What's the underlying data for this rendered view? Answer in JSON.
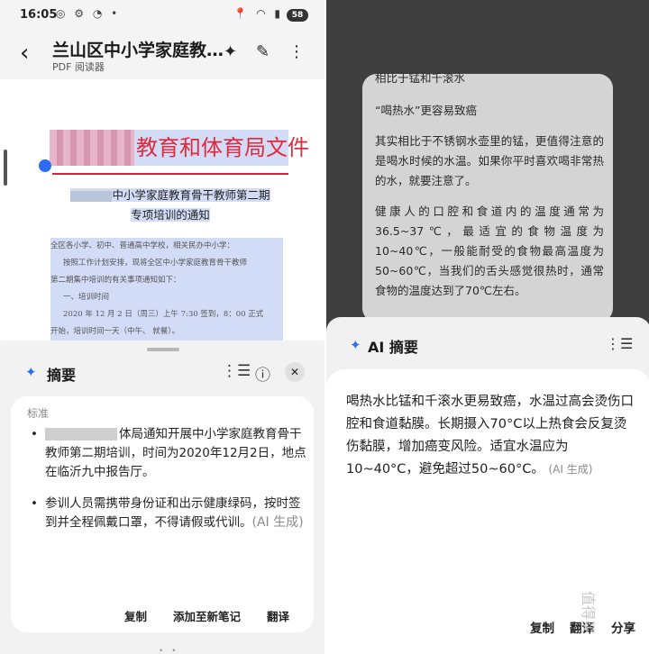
{
  "left": {
    "status": {
      "time": "16:05",
      "left_icons": "◎ ⚙ ◔ •",
      "right_icons": "📍 ◠ ▮",
      "battery": "58"
    },
    "appbar": {
      "title": "兰山区中小学家庭教…",
      "subtitle": "PDF 阅读器"
    },
    "document": {
      "heading_visible": "教育和体育局文件",
      "subheading_line1": "中小学家庭教育骨干教师第二期",
      "subheading_line2": "专项培训的通知",
      "body_lines": [
        "全区各小学、初中、普通高中学校，相关民办中小学：",
        "按照工作计划安排，现将全区中小学家庭教育骨干教师",
        "第二期集中培训的有关事项通知如下：",
        "一、培训时间",
        "2020 年 12 月 2 日（周三）上午 7:30 签到，8：00 正式",
        "开始，培训时间一天（中午、          就餐）。"
      ]
    },
    "summary_sheet": {
      "title": "摘要",
      "label": "标准",
      "bullet1_visible": "体局通知开展中小学家庭教育骨干教师第二期培训，时间为2020年12月2日，地点在临沂九中报告厅。",
      "bullet2": "参训人员需携带身份证和出示健康绿码，按时签到并全程佩戴口罩，不得请假或代训。",
      "ai_tag": "(AI 生成)",
      "actions": {
        "copy": "复制",
        "add_note": "添加至新笔记",
        "translate": "翻译"
      }
    }
  },
  "right": {
    "background_text": {
      "line1": "相比于锰和千滚水",
      "line2": "“喝热水”更容易致癌",
      "para1": "其实相比于不锈钢水壶里的锰，更值得注意的是喝水时候的水温。如果你平时喜欢喝非常热的水，就要注意了。",
      "para2": "健康人的口腔和食道内的温度通常为36.5~37℃，最适宜的食物温度为10~40℃，一般能耐受的食物最高温度为50~60℃，当我们的舌头感觉很热时，通常食物的温度达到了70℃左右。"
    },
    "ai_sheet": {
      "title": "AI 摘要",
      "summary": "喝热水比锰和千滚水更易致癌，水温过高会烫伤口腔和食道黏膜。长期摄入70°C以上热食会反复烫伤黏膜，增加癌变风险。适宜水温应为10~40°C，避免超过50~60°C。",
      "ai_tag": "(AI 生成)",
      "actions": {
        "copy": "复制",
        "translate": "翻译",
        "share": "分享"
      },
      "watermark": "值得买"
    }
  },
  "colors": {
    "accent": "#2d6cf6",
    "doc_red": "#e02a3c",
    "highlight": "#d2dcf7"
  }
}
